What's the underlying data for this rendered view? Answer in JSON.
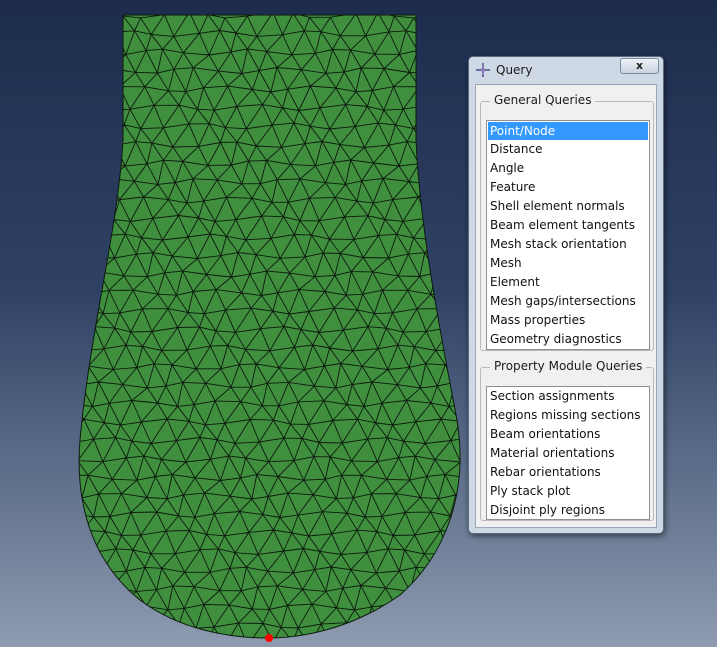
{
  "dialog": {
    "title": "Query",
    "close_label": "x",
    "general_group_title": "General Queries",
    "general_queries": [
      "Point/Node",
      "Distance",
      "Angle",
      "Feature",
      "Shell element normals",
      "Beam element tangents",
      "Mesh stack orientation",
      "Mesh",
      "Element",
      "Mesh gaps/intersections",
      "Mass properties",
      "Geometry diagnostics"
    ],
    "selected_query": "Point/Node",
    "property_group_title": "Property Module Queries",
    "property_queries": [
      "Section assignments",
      "Regions missing sections",
      "Beam orientations",
      "Material orientations",
      "Rebar orientations",
      "Ply stack plot",
      "Disjoint ply regions"
    ]
  },
  "viewport": {
    "mesh_fill_color": "#3f8f3f",
    "mesh_edge_color": "#0d1a0d",
    "picked_node_color": "#ff0000",
    "background_top": "#1d2c4c",
    "background_bottom": "#8e9bb0"
  }
}
